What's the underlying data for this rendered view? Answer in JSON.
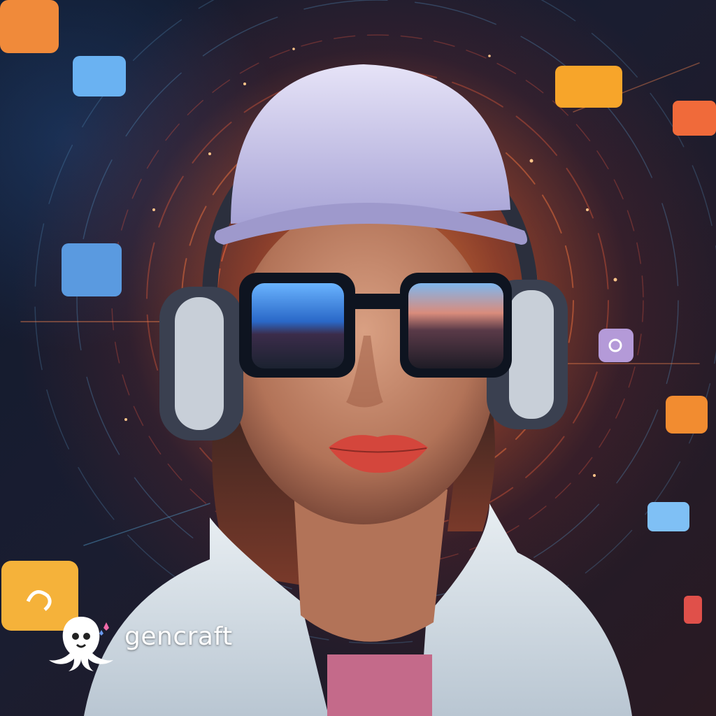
{
  "image": {
    "subject": "woman-with-cap-headphones-sunglasses",
    "palette": {
      "background_dark": "#101a2e",
      "glow_orange": "#ff8c3c",
      "cap": "#c9c6e8",
      "jacket": "#dfe7ec",
      "shirt": "#c46a8a",
      "lips": "#d4463c",
      "app_orange": "#f5a623",
      "app_blue": "#5aa8f0"
    },
    "floating_app_icons": [
      {
        "name": "orange-app-icon",
        "color": "#f08a3a"
      },
      {
        "name": "blue-app-icon",
        "color": "#6ab2f2"
      },
      {
        "name": "amber-app-icon",
        "color": "#f7a52a"
      },
      {
        "name": "red-orange-app-icon",
        "color": "#f06a3a"
      },
      {
        "name": "blue-app-icon",
        "color": "#5a9ae0"
      },
      {
        "name": "purple-app-icon",
        "color": "#b49ad8"
      },
      {
        "name": "orange-app-icon",
        "color": "#f28c30"
      },
      {
        "name": "blue-app-icon",
        "color": "#7fc0f5"
      },
      {
        "name": "yellow-app-icon",
        "color": "#f5b23a"
      }
    ]
  },
  "watermark": {
    "brand": "gencraft",
    "logo_icon": "octopus-icon",
    "color": "#ffffff"
  }
}
